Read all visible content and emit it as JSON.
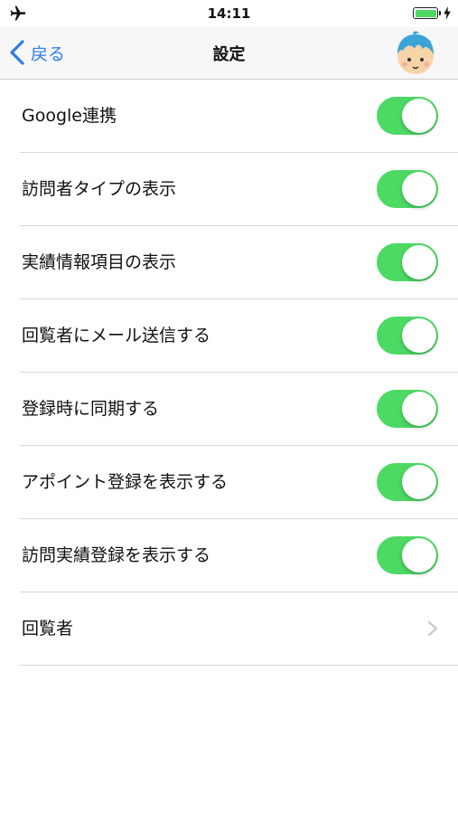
{
  "status_bar": {
    "time": "14:11",
    "left_icon": "airplane-icon",
    "battery_color": "#4cd964"
  },
  "nav": {
    "back_label": "戻る",
    "title": "設定",
    "accent_color": "#2f7de1"
  },
  "settings": {
    "toggle_on_color": "#4cd964",
    "rows": [
      {
        "label": "Google連携",
        "type": "toggle",
        "on": true
      },
      {
        "label": "訪問者タイプの表示",
        "type": "toggle",
        "on": true
      },
      {
        "label": "実績情報項目の表示",
        "type": "toggle",
        "on": true
      },
      {
        "label": "回覧者にメール送信する",
        "type": "toggle",
        "on": true
      },
      {
        "label": "登録時に同期する",
        "type": "toggle",
        "on": true
      },
      {
        "label": "アポイント登録を表示する",
        "type": "toggle",
        "on": true
      },
      {
        "label": "訪問実績登録を表示する",
        "type": "toggle",
        "on": true
      },
      {
        "label": "回覧者",
        "type": "disclosure",
        "icon": "chevron-right-icon"
      }
    ]
  }
}
